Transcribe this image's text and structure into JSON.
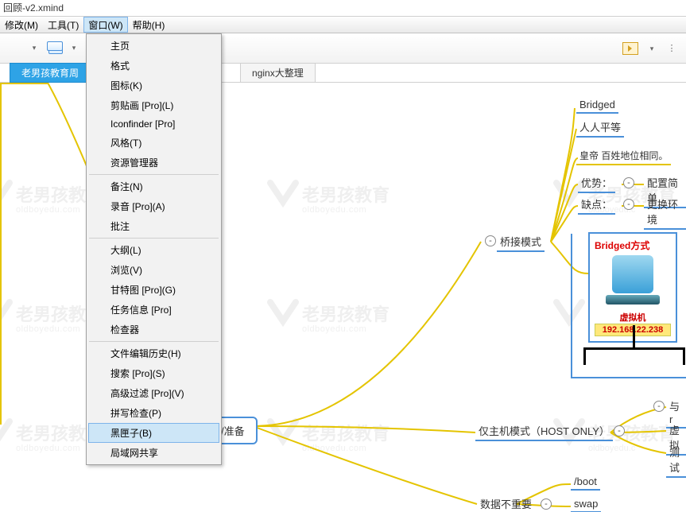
{
  "window_title": "回顾-v2.xmind",
  "menubar": {
    "modify": "修改(M)",
    "tools": "工具(T)",
    "window": "窗口(W)",
    "help": "帮助(H)"
  },
  "tabs": {
    "active": "老男孩教育周",
    "other": "nginx大整理"
  },
  "dropdown": {
    "items": [
      "主页",
      "格式",
      "图标(K)",
      "剪贴画 [Pro](L)",
      "Iconfinder [Pro]",
      "风格(T)",
      "资源管理器",
      "---",
      "备注(N)",
      "录音 [Pro](A)",
      "批注",
      "---",
      "大纲(L)",
      "浏览(V)",
      "甘特图 [Pro](G)",
      "任务信息 [Pro]",
      "检查器",
      "---",
      "文件编辑历史(H)",
      "搜索 [Pro](S)",
      "高级过滤 [Pro](V)",
      "拼写检查(P)",
      "黑匣子(B)",
      "局域网共享"
    ],
    "hover_index": 22
  },
  "nodes": {
    "env": "环境/准备",
    "bridged": "Bridged",
    "equal": "人人平等",
    "emperor": "皇帝  百姓地位相同。",
    "adv": "优势：",
    "adv_val": "配置简单",
    "dis": "缺点：",
    "dis_val": "更换环境",
    "bridge_mode": "桥接模式",
    "host_only": "仅主机模式（HOST ONLY）",
    "with_r": "与r",
    "virt": "虚拟",
    "test": "测试",
    "boot": "/boot",
    "swap": "swap",
    "data_unimportant": "数据不重要"
  },
  "diagram": {
    "title": "Bridged方式",
    "vm": "虚拟机",
    "ip": "192.168.22.238"
  },
  "watermark": {
    "cn": "老男孩教育",
    "en": "oldboyedu.com"
  }
}
